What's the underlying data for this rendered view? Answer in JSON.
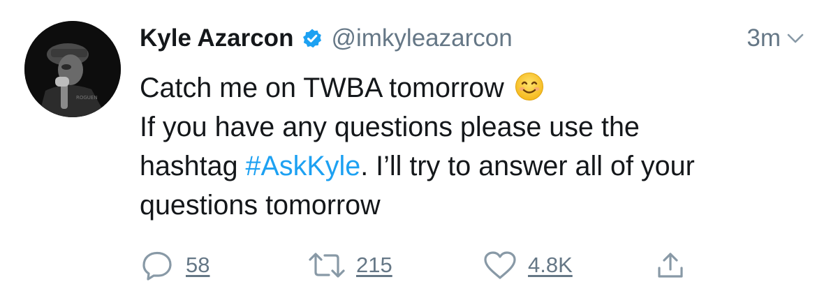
{
  "tweet": {
    "author": {
      "display_name": "Kyle Azarcon",
      "handle": "@imkyleazarcon",
      "verified": true
    },
    "time": "3m",
    "text": {
      "line1": "Catch me on TWBA tomorrow",
      "line1_emoji": "smiling-face-icon",
      "line2": "If you have any questions please use the",
      "line3_before": "hashtag ",
      "hashtag": "#AskKyle",
      "line3_after": ". I’ll try to answer all of your",
      "line4": "questions tomorrow"
    },
    "actions": {
      "reply_count": "58",
      "retweet_count": "215",
      "like_count": "4.8K"
    }
  },
  "colors": {
    "text": "#14171a",
    "secondary": "#657786",
    "accent": "#1da1f2",
    "icon": "#8899a6"
  }
}
